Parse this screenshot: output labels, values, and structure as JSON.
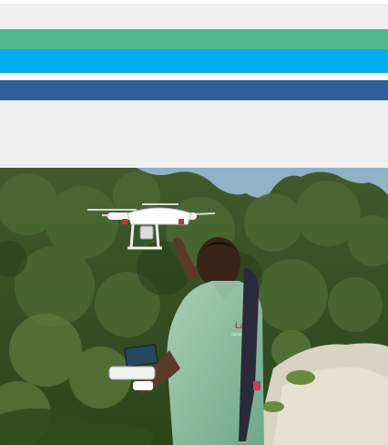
{
  "header": {
    "background": "#efefef"
  },
  "stripes": [
    {
      "name": "green",
      "color": "#50b98c"
    },
    {
      "name": "blue",
      "color": "#00adee"
    },
    {
      "name": "navy",
      "color": "#2f5f9a"
    }
  ],
  "panel": {
    "background": "#efefef"
  },
  "photo": {
    "shirt_logo": "Lab",
    "shirt_sub": "GEOSPATIAL"
  }
}
